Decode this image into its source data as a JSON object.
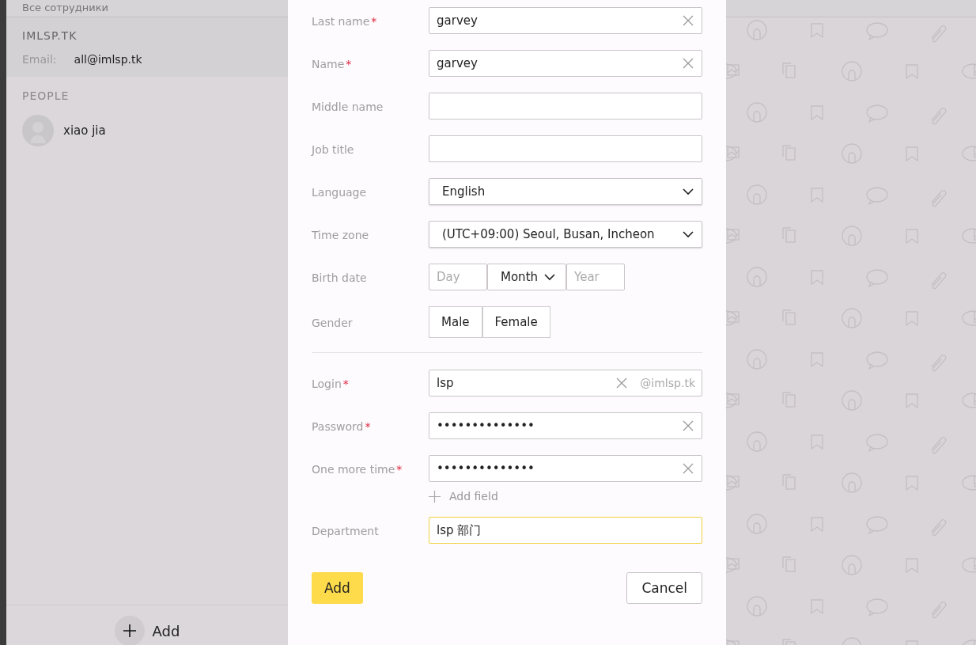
{
  "sidebar": {
    "header": "Все сотрудники",
    "org": {
      "name": "IMLSP.TK",
      "email_label": "Email:",
      "email": "all@imlsp.tk"
    },
    "people_title": "PEOPLE",
    "people": [
      {
        "name": "xiao jia"
      }
    ],
    "add_button": "Add"
  },
  "form": {
    "personal_fields": [
      {
        "kind": "text",
        "label": "Last name",
        "required_mark": "*",
        "value": "garvey",
        "clearable": true
      },
      {
        "kind": "text",
        "label": "Name",
        "required_mark": "*",
        "value": "garvey",
        "clearable": true
      },
      {
        "kind": "text",
        "label": "Middle name",
        "clearable": false
      },
      {
        "kind": "text",
        "label": "Job title",
        "clearable": false
      },
      {
        "kind": "select",
        "label": "Language",
        "value": "English"
      },
      {
        "kind": "select",
        "label": "Time zone",
        "value": "(UTC+09:00) Seoul, Busan, Incheon"
      },
      {
        "kind": "date",
        "label": "Birth date",
        "parts": [
          {
            "kind": "input",
            "placeholder": "Day"
          },
          {
            "kind": "select",
            "value": "Month"
          },
          {
            "kind": "input",
            "placeholder": "Year"
          }
        ]
      },
      {
        "kind": "choice",
        "label": "Gender",
        "options": [
          {
            "label": "Male",
            "selected": false
          },
          {
            "label": "Female",
            "selected": false
          }
        ]
      }
    ],
    "account_fields": [
      {
        "kind": "login",
        "label": "Login",
        "required_mark": "*",
        "value": "lsp",
        "suffix": "@imlsp.tk",
        "clearable": true
      },
      {
        "kind": "text",
        "label": "Password",
        "required_mark": "*",
        "value": "••••••••••••••",
        "clearable": true
      },
      {
        "kind": "text",
        "label": "One more time",
        "required_mark": "*",
        "value": "••••••••••••••",
        "clearable": true
      },
      {
        "kind": "link",
        "label": "Add field"
      },
      {
        "kind": "text",
        "label": "Department",
        "value": "lsp 部门",
        "focused": true,
        "clearable": false
      }
    ],
    "buttons": [
      {
        "label": "Add",
        "kind": "primary"
      },
      {
        "label": "Cancel",
        "kind": "secondary"
      }
    ]
  }
}
